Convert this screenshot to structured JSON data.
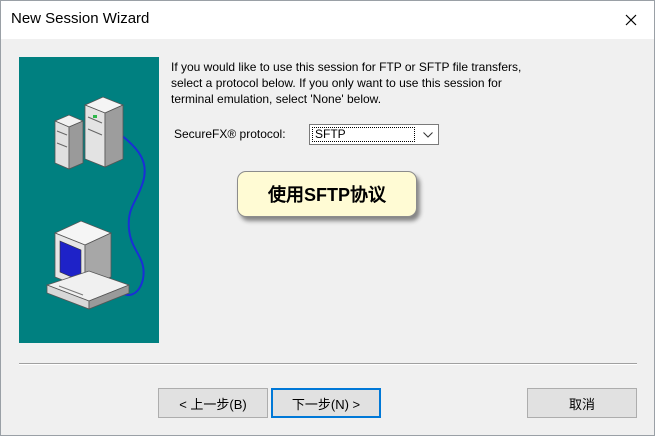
{
  "window": {
    "title": "New Session Wizard"
  },
  "description": {
    "line1": "If you would like to use this session for FTP or SFTP file transfers,",
    "line2": "select a protocol below.  If you only want to use this session for",
    "line3": "terminal emulation, select 'None' below."
  },
  "protocol": {
    "label": "SecureFX® protocol:",
    "selected": "SFTP"
  },
  "callout": {
    "text": "使用SFTP协议"
  },
  "buttons": {
    "back": "< 上一步(B)",
    "next": "下一步(N) >",
    "cancel": "取消"
  },
  "icons": {
    "close": "close-icon",
    "dropdown": "chevron-down-icon",
    "illustration": "network-servers-illustration"
  },
  "colors": {
    "panel_teal": "#008080",
    "callout_bg": "#fffbd4",
    "focus_blue": "#0078d7",
    "monitor_screen": "#1e22c8"
  }
}
